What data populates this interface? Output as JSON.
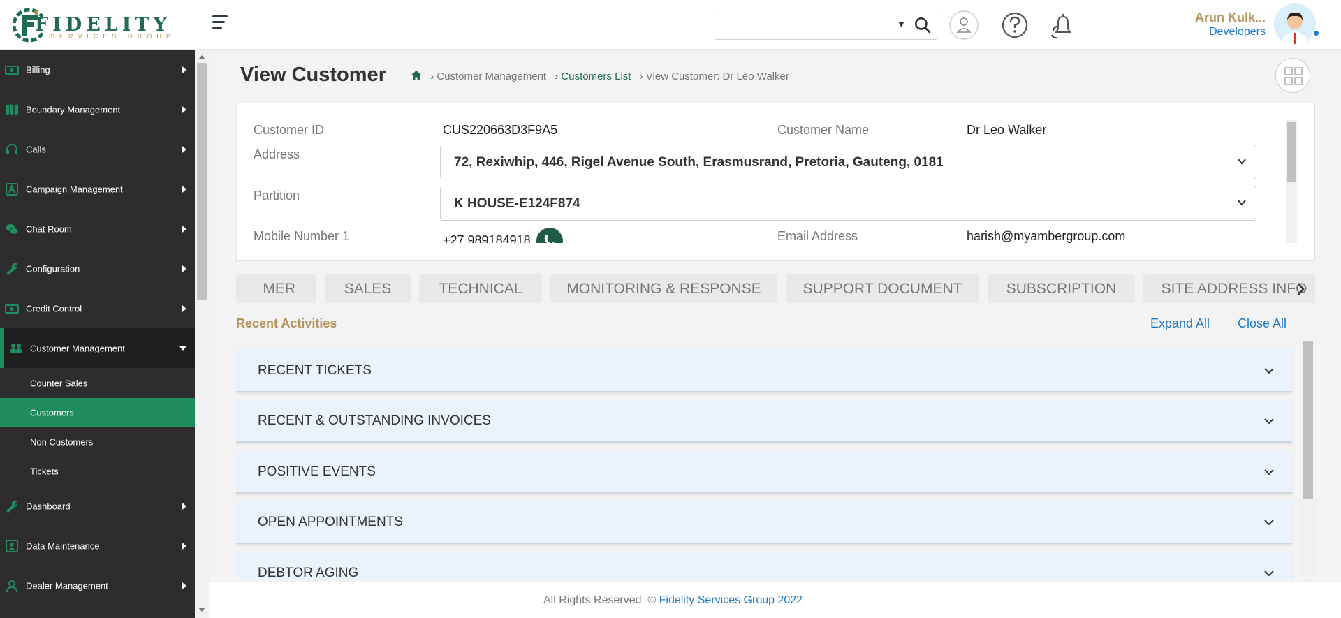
{
  "header": {
    "logo_name": "FIDELITY",
    "logo_tagline": "SERVICES GROUP",
    "search_value": "",
    "user_name": "Arun Kulk...",
    "user_role": "Developers"
  },
  "sidebar": {
    "items": [
      {
        "label": "Billing",
        "icon": "billing-icon"
      },
      {
        "label": "Boundary Management",
        "icon": "map-icon"
      },
      {
        "label": "Calls",
        "icon": "headset-icon"
      },
      {
        "label": "Campaign Management",
        "icon": "campaign-icon"
      },
      {
        "label": "Chat Room",
        "icon": "chat-icon"
      },
      {
        "label": "Configuration",
        "icon": "wrench-icon"
      },
      {
        "label": "Credit Control",
        "icon": "money-icon"
      },
      {
        "label": "Customer Management",
        "icon": "users-icon"
      }
    ],
    "sub_items": [
      {
        "label": "Counter Sales"
      },
      {
        "label": "Customers"
      },
      {
        "label": "Non Customers"
      },
      {
        "label": "Tickets"
      }
    ],
    "items_after": [
      {
        "label": "Dashboard",
        "icon": "wrench-icon"
      },
      {
        "label": "Data Maintenance",
        "icon": "data-icon"
      },
      {
        "label": "Dealer Management",
        "icon": "user-icon"
      }
    ]
  },
  "page": {
    "title": "View Customer",
    "breadcrumb": [
      "› Customer Management",
      "› Customers List",
      "› View Customer: Dr Leo Walker"
    ]
  },
  "customer": {
    "id_label": "Customer ID",
    "id_value": "CUS220663D3F9A5",
    "name_label": "Customer Name",
    "name_value": "Dr Leo Walker",
    "address_label": "Address",
    "address_value": "72, Rexiwhip, 446, Rigel Avenue South, Erasmusrand, Pretoria, Gauteng, 0181",
    "partition_label": "Partition",
    "partition_value": "K HOUSE-E124F874",
    "mobile_label": "Mobile Number 1",
    "mobile_value": "+27 989184918",
    "email_label": "Email Address",
    "email_value": "harish@myambergroup.com"
  },
  "tabs": [
    "MER",
    "SALES",
    "TECHNICAL",
    "MONITORING & RESPONSE",
    "SUPPORT DOCUMENT",
    "SUBSCRIPTION",
    "SITE ADDRESS INFO"
  ],
  "recent": {
    "title": "Recent Activities",
    "expand_all": "Expand All",
    "close_all": "Close All",
    "sections": [
      "RECENT TICKETS",
      "RECENT & OUTSTANDING INVOICES",
      "POSITIVE EVENTS",
      "OPEN APPOINTMENTS",
      "DEBTOR AGING"
    ]
  },
  "footer": {
    "text": "All Rights Reserved. © ",
    "brand": "Fidelity Services Group 2022"
  },
  "colors": {
    "brand_green": "#1f6b4d",
    "active_green": "#1f8c5e",
    "gold": "#b5935a",
    "link_blue": "#1f7ac7",
    "sidebar_bg": "#2d2d2d"
  }
}
